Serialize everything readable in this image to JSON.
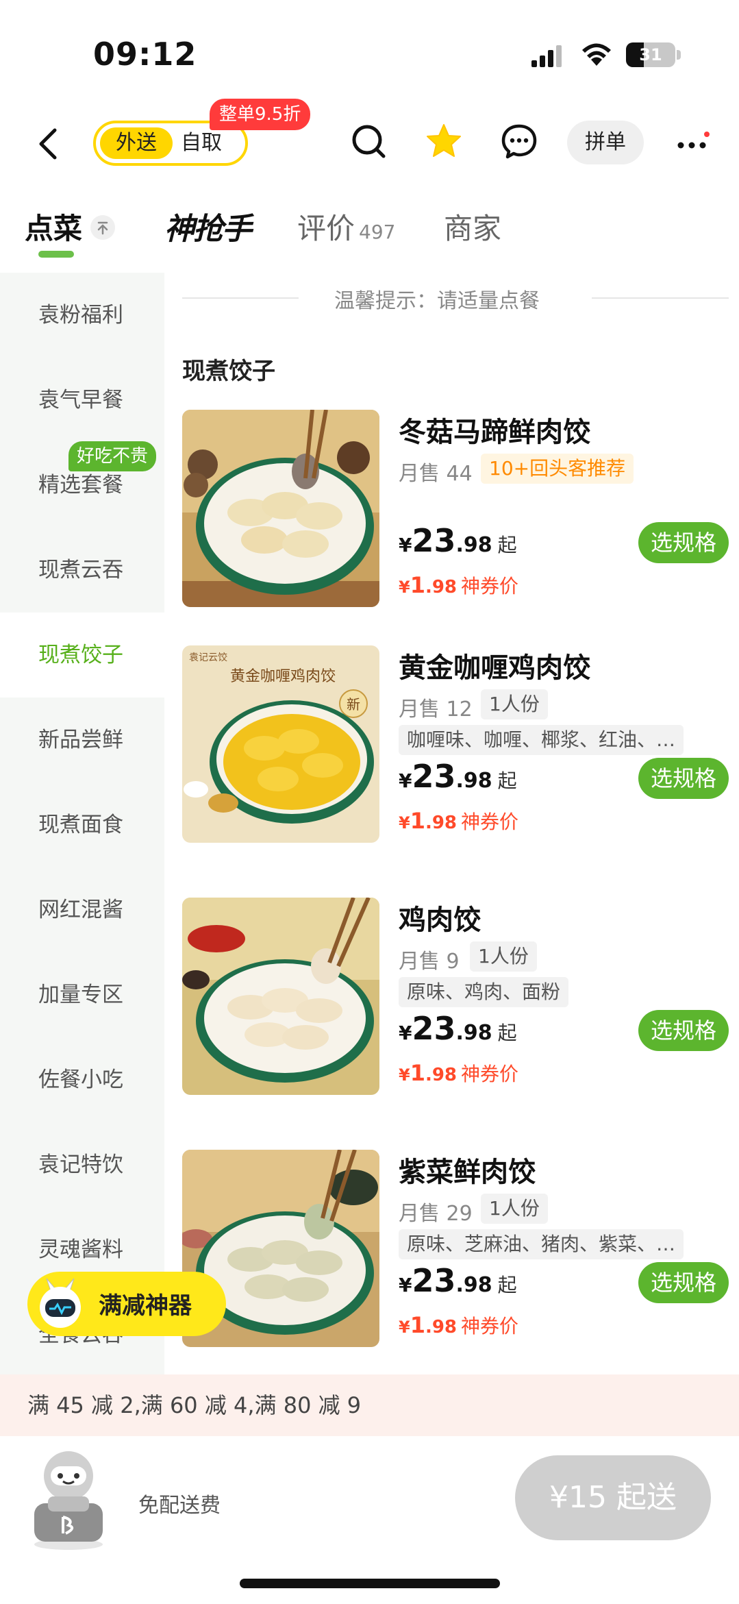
{
  "status_bar": {
    "time": "09:12",
    "battery": "31"
  },
  "header": {
    "mode_delivery": "外送",
    "mode_pickup": "自取",
    "discount_badge": "整单9.5折",
    "group_order": "拼单"
  },
  "tabs": {
    "order": "点菜",
    "flash": "神抢手",
    "reviews": "评价",
    "review_count": "497",
    "merchant": "商家"
  },
  "sidebar": {
    "items": [
      {
        "label": "袁粉福利"
      },
      {
        "label": "袁气早餐"
      },
      {
        "label": "精选套餐"
      },
      {
        "label": "现煮云吞"
      },
      {
        "label": "现煮饺子"
      },
      {
        "label": "新品尝鲜"
      },
      {
        "label": "现煮面食"
      },
      {
        "label": "网红混酱"
      },
      {
        "label": "加量专区"
      },
      {
        "label": "佐餐小吃"
      },
      {
        "label": "袁记特饮"
      },
      {
        "label": "灵魂酱料"
      },
      {
        "label": "全食云吞"
      }
    ],
    "active": "现煮饺子",
    "tag": "好吃不贵"
  },
  "main": {
    "tip": "温馨提示：请适量点餐",
    "section_title": "现煮饺子",
    "dishes": [
      {
        "name": "冬菇马蹄鲜肉饺",
        "sales": "月售 44",
        "badge": "10+回头客推荐",
        "price_yen": "¥",
        "price_int": "23",
        "price_dec": ".98",
        "price_suffix": "起",
        "coupon_yen": "¥",
        "coupon_int": "1",
        "coupon_dec": ".98",
        "coupon_label": "神券价",
        "button": "选规格"
      },
      {
        "name": "黄金咖喱鸡肉饺",
        "sales": "月售 12",
        "portion": "1人份",
        "ingredients": "咖喱味、咖喱、椰浆、红油、…",
        "price_yen": "¥",
        "price_int": "23",
        "price_dec": ".98",
        "price_suffix": "起",
        "coupon_yen": "¥",
        "coupon_int": "1",
        "coupon_dec": ".98",
        "coupon_label": "神券价",
        "button": "选规格",
        "image_text": "黄金咖喱鸡肉饺",
        "image_brand": "袁记云饺",
        "image_new": "新"
      },
      {
        "name": "鸡肉饺",
        "sales": "月售 9",
        "portion": "1人份",
        "ingredients": "原味、鸡肉、面粉",
        "price_yen": "¥",
        "price_int": "23",
        "price_dec": ".98",
        "price_suffix": "起",
        "coupon_yen": "¥",
        "coupon_int": "1",
        "coupon_dec": ".98",
        "coupon_label": "神券价",
        "button": "选规格"
      },
      {
        "name": "紫菜鲜肉饺",
        "sales": "月售 29",
        "portion": "1人份",
        "ingredients": "原味、芝麻油、猪肉、紫菜、…",
        "price_yen": "¥",
        "price_int": "23",
        "price_dec": ".98",
        "price_suffix": "起",
        "coupon_yen": "¥",
        "coupon_int": "1",
        "coupon_dec": ".98",
        "coupon_label": "神券价",
        "button": "选规格"
      }
    ]
  },
  "promo_float": {
    "label": "满减神器"
  },
  "discount_bar": {
    "text": "满 45 减 2,满 60 减 4,满 80 减 9"
  },
  "cart": {
    "free_delivery": "免配送费",
    "min_order": "¥15 起送"
  },
  "colors": {
    "accent_green": "#5cb52e",
    "active_green": "#57b01b",
    "brand_yellow": "#ffd600",
    "price_red": "#ff4a2a",
    "badge_red": "#ff3b3b"
  }
}
